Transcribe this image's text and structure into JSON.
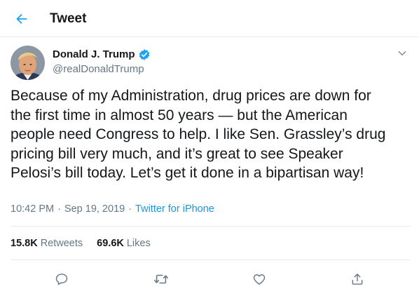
{
  "header": {
    "title": "Tweet",
    "back_icon": "back-arrow-icon"
  },
  "author": {
    "name": "Donald J. Trump",
    "handle": "@realDonaldTrump",
    "verified": true
  },
  "tweet": {
    "text": "Because of my Administration, drug prices are down for\nthe first time in almost 50 years — but the American\npeople need Congress to help. I like Sen. Grassley’s drug\npricing bill very much, and it’s great to see Speaker\nPelosi’s bill today. Let’s get it done in a bipartisan way!",
    "time": "10:42 PM",
    "separator": "·",
    "date": "Sep 19, 2019",
    "source": "Twitter for iPhone"
  },
  "stats": {
    "retweets_count": "15.8K",
    "retweets_label": "Retweets",
    "likes_count": "69.6K",
    "likes_label": "Likes"
  },
  "actions": [
    "reply-icon",
    "retweet-icon",
    "like-icon",
    "share-icon"
  ],
  "colors": {
    "accent": "#1da1f2",
    "link": "#1b95e0",
    "secondary_text": "#657786",
    "divider": "#e6ecf0"
  }
}
